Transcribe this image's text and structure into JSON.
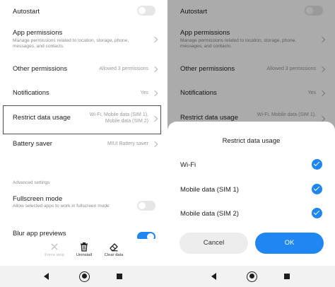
{
  "settings": {
    "autostart": {
      "title": "Autostart",
      "on": false
    },
    "app_permissions": {
      "title": "App permissions",
      "desc": "Manage permissions related to location, storage, phone, messages, and contacts."
    },
    "other_permissions": {
      "title": "Other permissions",
      "value": "Allowed 3 permissions"
    },
    "notifications": {
      "title": "Notifications",
      "value": "Yes"
    },
    "restrict_data": {
      "title": "Restrict data usage",
      "value_line1": "Wi-Fi, Mobile data (SIM 1),",
      "value_line2": "Mobile data (SIM 2)"
    },
    "battery_saver": {
      "title": "Battery saver",
      "value": "MIUI Battery saver"
    },
    "advanced_header": "Advanced settings",
    "fullscreen": {
      "title": "Fullscreen mode",
      "desc": "Allow selected apps to work in fullscreen mode",
      "on": false
    },
    "blur": {
      "title": "Blur app previews",
      "on": true
    }
  },
  "actions": {
    "force_stop": "Force stop",
    "uninstall": "Uninstall",
    "clear_data": "Clear data"
  },
  "dialog": {
    "title": "Restrict data usage",
    "options": [
      {
        "label": "Wi-Fi",
        "checked": true
      },
      {
        "label": "Mobile data (SIM 1)",
        "checked": true
      },
      {
        "label": "Mobile data (SIM 2)",
        "checked": true
      }
    ],
    "cancel_label": "Cancel",
    "ok_label": "OK"
  },
  "colors": {
    "accent": "#1f86f2",
    "toggle_off": "#e6e6e6",
    "highlight_border": "#4a4a4a"
  },
  "icons": {
    "force_stop": "close-x-icon",
    "uninstall": "trash-icon",
    "clear_data": "eraser-icon",
    "nav_back": "back-triangle-icon",
    "nav_home": "home-circle-icon",
    "nav_recent": "recent-square-icon",
    "chevron": "chevron-right-icon",
    "check": "check-circle-icon"
  }
}
